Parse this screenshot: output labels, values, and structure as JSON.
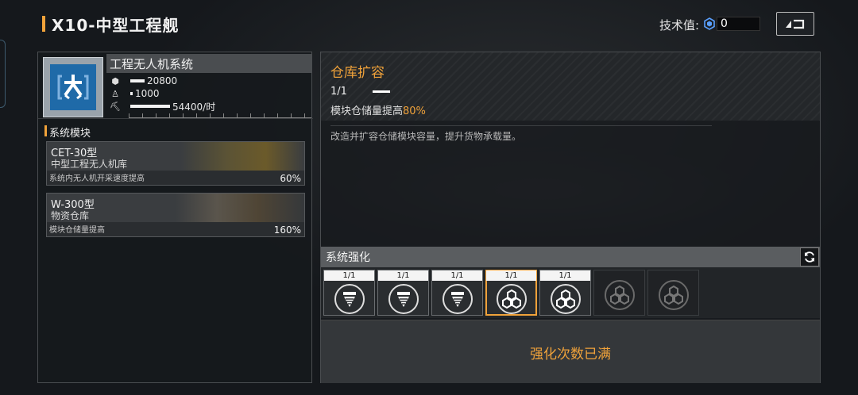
{
  "header": {
    "title": "X10-中型工程舰",
    "tech_label": "技术值:",
    "tech_value": "0",
    "back_icon": "back-arrow-icon"
  },
  "system": {
    "name": "工程无人机系统",
    "icon": "drone-system-icon",
    "stats": [
      {
        "icon": "cube-icon",
        "value": "20800"
      },
      {
        "icon": "drone-icon",
        "value": "1000"
      },
      {
        "icon": "excavator-icon",
        "value": "54400/时"
      }
    ]
  },
  "modules": {
    "title": "系统模块",
    "items": [
      {
        "name": "CET-30型",
        "sub": "中型工程无人机库",
        "desc": "系统内无人机开采速度提高",
        "pct": "60%"
      },
      {
        "name": "W-300型",
        "sub": "物资仓库",
        "desc": "模块仓储量提高",
        "pct": "160%"
      }
    ]
  },
  "detail": {
    "title": "仓库扩容",
    "level": "1/1",
    "effect_prefix": "模块仓储量提高",
    "effect_value": "80%",
    "description": "改造并扩容仓储模块容量，提升货物承载量。"
  },
  "enhance": {
    "title": "系统强化",
    "refresh_icon": "refresh-icon",
    "slots": [
      {
        "level": "1/1",
        "icon": "drill-icon",
        "state": "normal"
      },
      {
        "level": "1/1",
        "icon": "drill-icon",
        "state": "normal"
      },
      {
        "level": "1/1",
        "icon": "drill-icon",
        "state": "normal"
      },
      {
        "level": "1/1",
        "icon": "crates-icon",
        "state": "selected"
      },
      {
        "level": "1/1",
        "icon": "crates-icon",
        "state": "normal"
      },
      {
        "level": "",
        "icon": "crates-icon",
        "state": "locked"
      },
      {
        "level": "",
        "icon": "crates-icon",
        "state": "locked"
      }
    ],
    "maxed_text": "强化次数已满"
  },
  "colors": {
    "accent": "#f0a23a",
    "panel": "#24272a",
    "stat_bar": "#f2f2f2"
  }
}
